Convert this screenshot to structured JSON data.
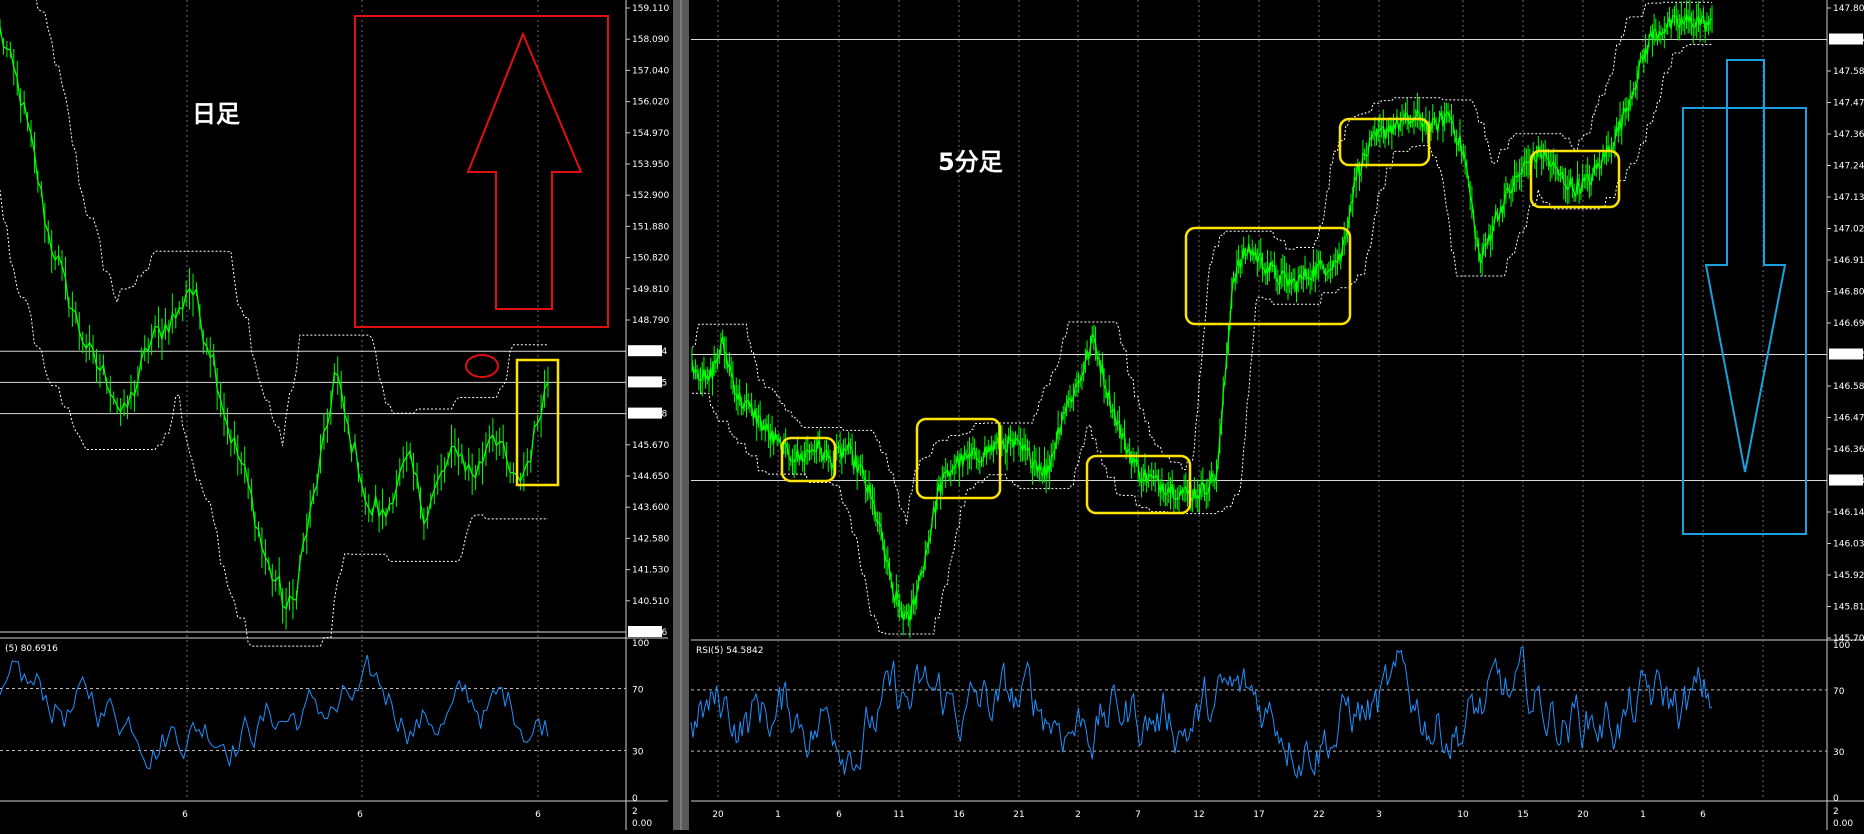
{
  "charts": [
    {
      "id": "daily",
      "annotation": "日足",
      "price_ticks": [
        "159.110",
        "158.090",
        "157.040",
        "156.020",
        "154.970",
        "153.950",
        "152.900",
        "151.880",
        "150.820",
        "149.810",
        "148.790",
        "147.704",
        "146.655",
        "146.248",
        "145.670",
        "144.650",
        "143.600",
        "142.580",
        "141.530",
        "140.510",
        "139.606"
      ],
      "price_highlight": [
        "147.704",
        "146.655",
        "146.248",
        "139.606"
      ],
      "x_labels": [
        "6",
        "6",
        "6"
      ],
      "rsi_label": "(5) 80.6916",
      "rsi_ticks": [
        "100",
        "70",
        "30",
        "0"
      ],
      "sub_ticks": [
        "2",
        "0.00"
      ]
    },
    {
      "id": "5min",
      "annotation": "5分足",
      "price_ticks": [
        "147.800",
        "147.704",
        "147.580",
        "147.470",
        "147.360",
        "147.245",
        "147.135",
        "147.025",
        "146.915",
        "146.805",
        "146.690",
        "146.655",
        "146.580",
        "146.470",
        "146.360",
        "146.248",
        "146.140",
        "146.030",
        "145.920",
        "145.810",
        "145.700"
      ],
      "price_highlight": [
        "147.704",
        "146.655",
        "146.248"
      ],
      "x_labels": [
        "20",
        "1",
        "6",
        "11",
        "16",
        "21",
        "2",
        "7",
        "12",
        "17",
        "22",
        "3",
        "10",
        "15",
        "20",
        "1",
        "6"
      ],
      "rsi_label": "RSI(5) 54.5842",
      "rsi_ticks": [
        "100",
        "70",
        "30",
        "0"
      ],
      "sub_ticks": [
        "2",
        "0.00"
      ]
    }
  ],
  "colors": {
    "background": "#000000",
    "candle": "#00ff00",
    "rsi_line": "#1e90ff",
    "band": "#ffffff",
    "box_yellow": "#ffe400",
    "arrow_red": "#e01010",
    "arrow_blue": "#1aa0e0"
  },
  "chart_data": [
    {
      "type": "line",
      "title": "日足",
      "ylim": [
        139.606,
        159.11
      ],
      "x_ticks": [
        "6",
        "6",
        "6"
      ],
      "series": [
        {
          "name": "",
          "values": [
            158.4,
            157.6,
            156.9,
            155.8,
            154.7,
            153.3,
            151.9,
            151.3,
            150.4,
            149.6,
            148.9,
            148.3,
            147.9,
            147.6,
            147.0,
            146.3,
            146.9,
            147.6,
            148.5,
            148.9,
            149.1,
            149.4,
            149.6,
            150.5,
            150.0,
            148.9,
            148.3,
            147.0,
            145.9,
            145.2,
            144.5,
            143.5,
            142.3,
            141.5,
            141.1,
            140.3,
            140.6,
            142.2,
            143.3,
            144.7,
            146.0,
            147.9,
            146.5,
            145.5,
            144.8,
            143.2,
            143.6,
            143.1,
            144.0,
            144.5,
            145.0,
            144.2,
            143.2,
            143.9,
            144.5,
            145.0,
            145.4,
            144.8,
            144.5,
            145.0,
            146.0,
            145.6,
            144.8,
            144.2,
            144.6,
            145.3,
            146.6,
            147.5
          ]
        }
      ]
    },
    {
      "type": "line",
      "title": "5分足",
      "ylim": [
        145.7,
        147.8
      ],
      "x_ticks": [
        "20",
        "1",
        "6",
        "11",
        "16",
        "21",
        "2",
        "7",
        "12",
        "17",
        "22",
        "3",
        "10",
        "15",
        "20",
        "1",
        "6"
      ],
      "series": [
        {
          "name": "",
          "values": [
            146.62,
            146.55,
            146.68,
            146.5,
            146.45,
            146.38,
            146.32,
            146.3,
            146.34,
            146.29,
            146.33,
            146.25,
            146.1,
            145.85,
            145.75,
            145.95,
            146.2,
            146.28,
            146.3,
            146.32,
            146.35,
            146.34,
            146.3,
            146.25,
            146.45,
            146.55,
            146.7,
            146.5,
            146.35,
            146.25,
            146.22,
            146.2,
            146.18,
            146.19,
            146.25,
            146.9,
            147.0,
            146.95,
            146.9,
            146.88,
            146.92,
            146.94,
            146.97,
            147.25,
            147.35,
            147.4,
            147.42,
            147.43,
            147.4,
            147.45,
            147.3,
            146.95,
            147.1,
            147.2,
            147.28,
            147.32,
            147.25,
            147.2,
            147.22,
            147.3,
            147.4,
            147.55,
            147.7,
            147.74,
            147.75,
            147.76,
            147.74
          ]
        }
      ]
    }
  ]
}
